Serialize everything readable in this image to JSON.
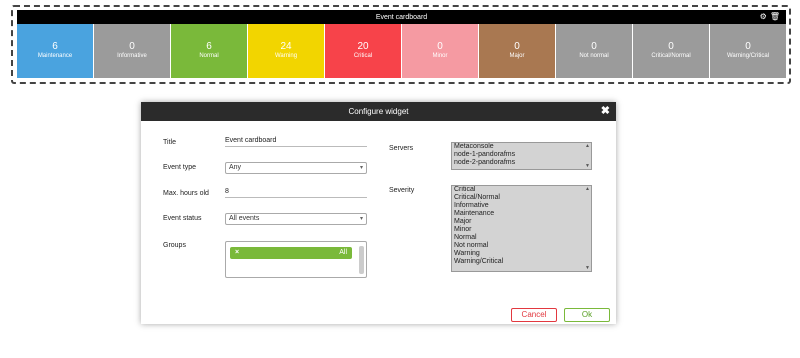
{
  "widget": {
    "title": "Event cardboard",
    "tools": [
      {
        "icon": "gear-icon",
        "glyph": "⚙"
      },
      {
        "icon": "trash-icon",
        "glyph": "🗑"
      }
    ],
    "tiles": [
      {
        "count": "6",
        "label": "Maintenance",
        "color": "#4aa3df"
      },
      {
        "count": "0",
        "label": "Informative",
        "color": "#9b9b9b"
      },
      {
        "count": "6",
        "label": "Normal",
        "color": "#7ab93a"
      },
      {
        "count": "24",
        "label": "Warning",
        "color": "#f2d500"
      },
      {
        "count": "20",
        "label": "Critical",
        "color": "#f7434a"
      },
      {
        "count": "0",
        "label": "Minor",
        "color": "#f59aa2"
      },
      {
        "count": "0",
        "label": "Major",
        "color": "#a97851"
      },
      {
        "count": "0",
        "label": "Not normal",
        "color": "#9b9b9b"
      },
      {
        "count": "0",
        "label": "Critical/Normal",
        "color": "#9b9b9b"
      },
      {
        "count": "0",
        "label": "Warning/Critical",
        "color": "#9b9b9b"
      }
    ]
  },
  "dialog": {
    "title": "Configure widget",
    "close_glyph": "✖",
    "fields": {
      "title_label": "Title",
      "title_value": "Event cardboard",
      "event_type_label": "Event type",
      "event_type_value": "Any",
      "max_hours_label": "Max. hours old",
      "max_hours_value": "8",
      "event_status_label": "Event status",
      "event_status_value": "All events",
      "groups_label": "Groups",
      "group_chip_value": "All",
      "group_chip_remove": "×",
      "servers_label": "Servers",
      "servers_options": [
        "Metaconsole",
        "node-1-pandorafms",
        "node-2-pandorafms"
      ],
      "severity_label": "Severity",
      "severity_options": [
        "Critical",
        "Critical/Normal",
        "Informative",
        "Maintenance",
        "Major",
        "Minor",
        "Normal",
        "Not normal",
        "Warning",
        "Warning/Critical"
      ]
    },
    "buttons": {
      "cancel": "Cancel",
      "ok": "Ok"
    }
  },
  "chevron_glyph": "▾"
}
